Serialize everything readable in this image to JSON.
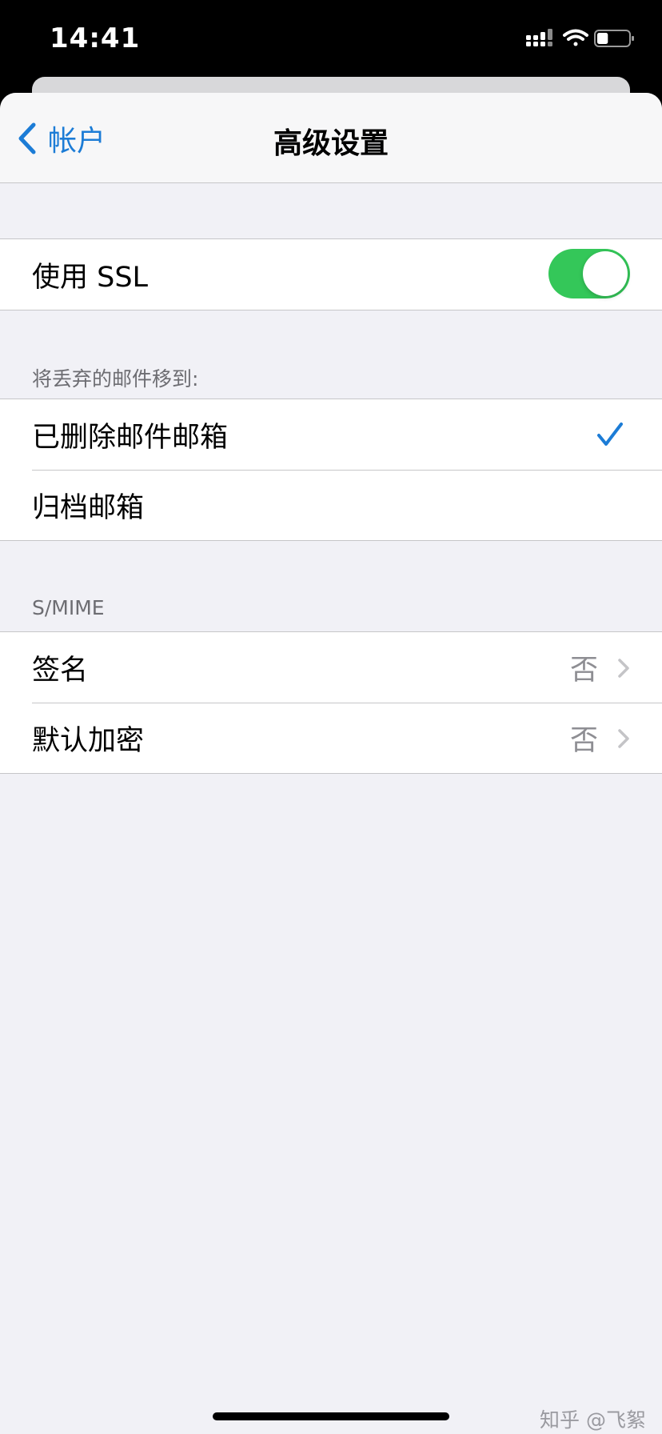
{
  "status_bar": {
    "time": "14:41",
    "icons": [
      "cellular-signal-icon",
      "wifi-icon",
      "battery-icon"
    ],
    "battery_level": 0.35
  },
  "nav": {
    "back_label": "帐户",
    "title": "高级设置"
  },
  "ssl": {
    "label": "使用 SSL",
    "enabled": true
  },
  "discard_section": {
    "header": "将丢弃的邮件移到:",
    "options": [
      {
        "label": "已删除邮件邮箱",
        "selected": true
      },
      {
        "label": "归档邮箱",
        "selected": false
      }
    ]
  },
  "smime_section": {
    "header": "S/MIME",
    "rows": [
      {
        "label": "签名",
        "value": "否"
      },
      {
        "label": "默认加密",
        "value": "否"
      }
    ]
  },
  "watermark": "知乎 @飞絮",
  "colors": {
    "accent": "#1c7cd6",
    "toggle_on": "#34c759",
    "background": "#f1f1f6",
    "secondary_text": "#8e8e93"
  }
}
